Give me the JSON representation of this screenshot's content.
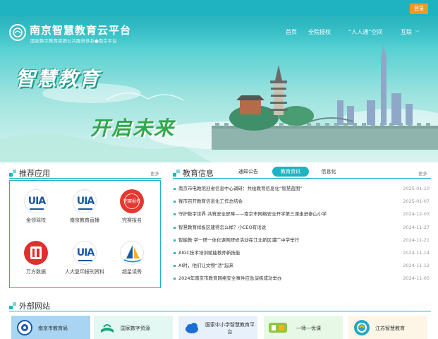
{
  "header": {
    "login_label": "登录",
    "site_title": "南京智慧教育云平台",
    "site_subtitle": "国家数字教育资源公共服务体系●南京平台",
    "nav": {
      "home": "首页",
      "auth": "全院授权",
      "renren": "“人人通”空间",
      "hudong": "互联"
    }
  },
  "banner": {
    "slogan_line1": "智慧教育",
    "slogan_line2": "开启未来"
  },
  "recommend": {
    "title": "推荐应用",
    "more": "更多",
    "apps": [
      {
        "label": "金领驾校",
        "icon": "uia-logo-icon",
        "mark": "UIA"
      },
      {
        "label": "南京教育直播",
        "icon": "uia-logo-icon",
        "mark": "UIA"
      },
      {
        "label": "完赛报名",
        "icon": "red-seal-icon",
        "mark": "完赛报名"
      },
      {
        "label": "万方数据",
        "icon": "wanfang-icon",
        "mark": ""
      },
      {
        "label": "人大复印报刊资料",
        "icon": "uia-logo-icon",
        "mark": "UIA"
      },
      {
        "label": "超星读秀",
        "icon": "sailboat-icon",
        "mark": ""
      }
    ]
  },
  "edu": {
    "title": "教育信息",
    "tabs": [
      "通知公告",
      "教育资讯",
      "信息化"
    ],
    "active_tab": "教育资讯",
    "more": "更多",
    "news": [
      {
        "title": "南京市电教馆迎省信息中心调研：共绘教育信息化“智慧蓝图”",
        "date": "2025-01-10"
      },
      {
        "title": "我市召开教育信息化工作总结会",
        "date": "2025-01-07"
      },
      {
        "title": "守护数字世界 共筑安全屏障——南京市网络安全开学第三课走进泰山小学",
        "date": "2024-12-03"
      },
      {
        "title": "智慧教育样板区建得怎么样？小CEO有话说",
        "date": "2024-11-27"
      },
      {
        "title": "智能教·学一研一体化课例研修活动在江北新区浦厂中学举行",
        "date": "2024-11-21"
      },
      {
        "title": "AIGC技术培训赋能教师新技能",
        "date": "2024-11-14"
      },
      {
        "title": "AI时，他们让文物“活”起来",
        "date": "2024-11-12"
      },
      {
        "title": "2024年南京市教育网络安全事件应急演练成功举办",
        "date": "2024-11-05"
      }
    ]
  },
  "external": {
    "title": "外部网站",
    "sites": [
      {
        "label": "南京市教育局",
        "icon": "nanjing-edu-emblem-icon"
      },
      {
        "label": "国家数字资源",
        "icon": "book-icon"
      },
      {
        "label": "国家中小学智慧教育平台",
        "icon": "cloud-icon"
      },
      {
        "label": "一师一优课",
        "icon": "youke-icon"
      },
      {
        "label": "江苏智慧教育",
        "icon": "jiangsu-edu-icon"
      }
    ]
  },
  "colors": {
    "accent": "#1fb3c2",
    "login": "#f39a1e",
    "slogan_green": "#2ea84a"
  }
}
